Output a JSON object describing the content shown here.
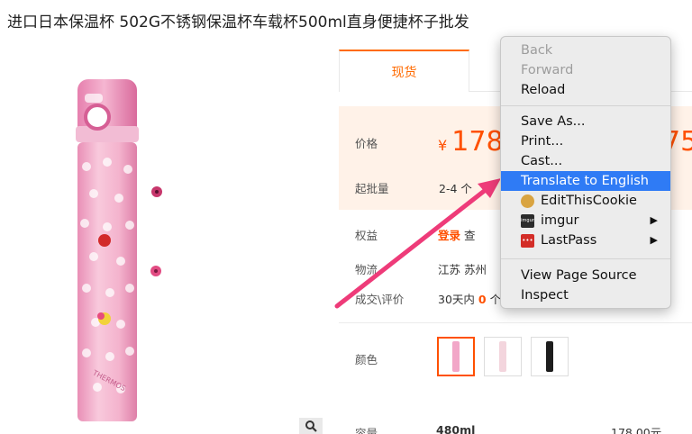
{
  "product": {
    "title": "进口日本保温杯 502G不锈钢保温杯车载杯500ml直身便捷杯子批发",
    "brand_text": "THERMOS"
  },
  "tabs": [
    {
      "label": "现货"
    }
  ],
  "price_block": {
    "price_label": "价格",
    "currency": "¥",
    "price_visible": "178",
    "price_partial": "75",
    "moq_label": "起批量",
    "moq_value": "2-4 个"
  },
  "info_rows": {
    "benefits_label": "权益",
    "login_link": "登录",
    "benefits_suffix": "查",
    "logistics_label": "物流",
    "logistics_value": "江苏 苏州",
    "deals_label": "成交\\评价",
    "deals_prefix": "30天内",
    "deals_count": "0",
    "deals_unit": "个"
  },
  "options": {
    "color_label": "颜色",
    "capacity_label": "容量",
    "capacity_value": "480ml",
    "capacity_price": "178.00元"
  },
  "context_menu": {
    "items": [
      {
        "label": "Back",
        "disabled": true
      },
      {
        "label": "Forward",
        "disabled": true
      },
      {
        "label": "Reload",
        "disabled": false
      },
      {
        "label": "Save As...",
        "disabled": false
      },
      {
        "label": "Print...",
        "disabled": false
      },
      {
        "label": "Cast...",
        "disabled": false
      },
      {
        "label": "Translate to English",
        "disabled": false,
        "highlighted": true
      },
      {
        "label": "EditThisCookie",
        "icon": "cookie-icon"
      },
      {
        "label": "imgur",
        "icon": "imgur-icon",
        "submenu": true
      },
      {
        "label": "LastPass",
        "icon": "lastpass-icon",
        "submenu": true
      },
      {
        "label": "View Page Source",
        "disabled": false
      },
      {
        "label": "Inspect",
        "disabled": false
      }
    ],
    "imgur_icon_text": "imgur",
    "lastpass_icon_text": "•••"
  },
  "colors": {
    "accent": "#ff5000",
    "highlight": "#2f7bf5",
    "annotation_arrow": "#ee3b79",
    "price_bg": "#fff2e8"
  }
}
